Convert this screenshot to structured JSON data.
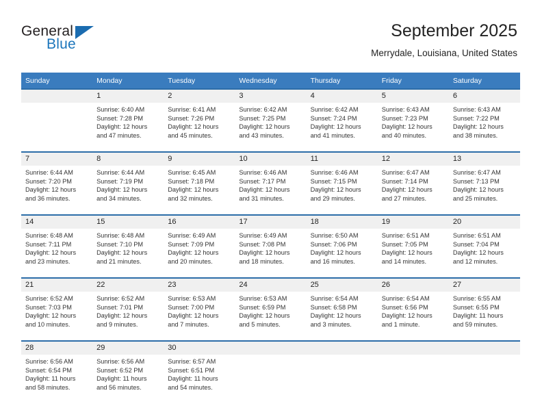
{
  "brand": {
    "line1": "General",
    "line2": "Blue",
    "accent_color": "#1b75bb",
    "triangle_icon": "triangle-logo-icon"
  },
  "header": {
    "title": "September 2025",
    "location": "Merrydale, Louisiana, United States"
  },
  "weekdays": [
    "Sunday",
    "Monday",
    "Tuesday",
    "Wednesday",
    "Thursday",
    "Friday",
    "Saturday"
  ],
  "colors": {
    "header_band": "#3a7cbe",
    "week_rule": "#2c6da8",
    "daynum_band": "#f0f0f0"
  },
  "weeks": [
    [
      {
        "day": "",
        "sunrise": "",
        "sunset": "",
        "daylight1": "",
        "daylight2": "",
        "empty": true
      },
      {
        "day": "1",
        "sunrise": "Sunrise: 6:40 AM",
        "sunset": "Sunset: 7:28 PM",
        "daylight1": "Daylight: 12 hours",
        "daylight2": "and 47 minutes.",
        "empty": false
      },
      {
        "day": "2",
        "sunrise": "Sunrise: 6:41 AM",
        "sunset": "Sunset: 7:26 PM",
        "daylight1": "Daylight: 12 hours",
        "daylight2": "and 45 minutes.",
        "empty": false
      },
      {
        "day": "3",
        "sunrise": "Sunrise: 6:42 AM",
        "sunset": "Sunset: 7:25 PM",
        "daylight1": "Daylight: 12 hours",
        "daylight2": "and 43 minutes.",
        "empty": false
      },
      {
        "day": "4",
        "sunrise": "Sunrise: 6:42 AM",
        "sunset": "Sunset: 7:24 PM",
        "daylight1": "Daylight: 12 hours",
        "daylight2": "and 41 minutes.",
        "empty": false
      },
      {
        "day": "5",
        "sunrise": "Sunrise: 6:43 AM",
        "sunset": "Sunset: 7:23 PM",
        "daylight1": "Daylight: 12 hours",
        "daylight2": "and 40 minutes.",
        "empty": false
      },
      {
        "day": "6",
        "sunrise": "Sunrise: 6:43 AM",
        "sunset": "Sunset: 7:22 PM",
        "daylight1": "Daylight: 12 hours",
        "daylight2": "and 38 minutes.",
        "empty": false
      }
    ],
    [
      {
        "day": "7",
        "sunrise": "Sunrise: 6:44 AM",
        "sunset": "Sunset: 7:20 PM",
        "daylight1": "Daylight: 12 hours",
        "daylight2": "and 36 minutes.",
        "empty": false
      },
      {
        "day": "8",
        "sunrise": "Sunrise: 6:44 AM",
        "sunset": "Sunset: 7:19 PM",
        "daylight1": "Daylight: 12 hours",
        "daylight2": "and 34 minutes.",
        "empty": false
      },
      {
        "day": "9",
        "sunrise": "Sunrise: 6:45 AM",
        "sunset": "Sunset: 7:18 PM",
        "daylight1": "Daylight: 12 hours",
        "daylight2": "and 32 minutes.",
        "empty": false
      },
      {
        "day": "10",
        "sunrise": "Sunrise: 6:46 AM",
        "sunset": "Sunset: 7:17 PM",
        "daylight1": "Daylight: 12 hours",
        "daylight2": "and 31 minutes.",
        "empty": false
      },
      {
        "day": "11",
        "sunrise": "Sunrise: 6:46 AM",
        "sunset": "Sunset: 7:15 PM",
        "daylight1": "Daylight: 12 hours",
        "daylight2": "and 29 minutes.",
        "empty": false
      },
      {
        "day": "12",
        "sunrise": "Sunrise: 6:47 AM",
        "sunset": "Sunset: 7:14 PM",
        "daylight1": "Daylight: 12 hours",
        "daylight2": "and 27 minutes.",
        "empty": false
      },
      {
        "day": "13",
        "sunrise": "Sunrise: 6:47 AM",
        "sunset": "Sunset: 7:13 PM",
        "daylight1": "Daylight: 12 hours",
        "daylight2": "and 25 minutes.",
        "empty": false
      }
    ],
    [
      {
        "day": "14",
        "sunrise": "Sunrise: 6:48 AM",
        "sunset": "Sunset: 7:11 PM",
        "daylight1": "Daylight: 12 hours",
        "daylight2": "and 23 minutes.",
        "empty": false
      },
      {
        "day": "15",
        "sunrise": "Sunrise: 6:48 AM",
        "sunset": "Sunset: 7:10 PM",
        "daylight1": "Daylight: 12 hours",
        "daylight2": "and 21 minutes.",
        "empty": false
      },
      {
        "day": "16",
        "sunrise": "Sunrise: 6:49 AM",
        "sunset": "Sunset: 7:09 PM",
        "daylight1": "Daylight: 12 hours",
        "daylight2": "and 20 minutes.",
        "empty": false
      },
      {
        "day": "17",
        "sunrise": "Sunrise: 6:49 AM",
        "sunset": "Sunset: 7:08 PM",
        "daylight1": "Daylight: 12 hours",
        "daylight2": "and 18 minutes.",
        "empty": false
      },
      {
        "day": "18",
        "sunrise": "Sunrise: 6:50 AM",
        "sunset": "Sunset: 7:06 PM",
        "daylight1": "Daylight: 12 hours",
        "daylight2": "and 16 minutes.",
        "empty": false
      },
      {
        "day": "19",
        "sunrise": "Sunrise: 6:51 AM",
        "sunset": "Sunset: 7:05 PM",
        "daylight1": "Daylight: 12 hours",
        "daylight2": "and 14 minutes.",
        "empty": false
      },
      {
        "day": "20",
        "sunrise": "Sunrise: 6:51 AM",
        "sunset": "Sunset: 7:04 PM",
        "daylight1": "Daylight: 12 hours",
        "daylight2": "and 12 minutes.",
        "empty": false
      }
    ],
    [
      {
        "day": "21",
        "sunrise": "Sunrise: 6:52 AM",
        "sunset": "Sunset: 7:03 PM",
        "daylight1": "Daylight: 12 hours",
        "daylight2": "and 10 minutes.",
        "empty": false
      },
      {
        "day": "22",
        "sunrise": "Sunrise: 6:52 AM",
        "sunset": "Sunset: 7:01 PM",
        "daylight1": "Daylight: 12 hours",
        "daylight2": "and 9 minutes.",
        "empty": false
      },
      {
        "day": "23",
        "sunrise": "Sunrise: 6:53 AM",
        "sunset": "Sunset: 7:00 PM",
        "daylight1": "Daylight: 12 hours",
        "daylight2": "and 7 minutes.",
        "empty": false
      },
      {
        "day": "24",
        "sunrise": "Sunrise: 6:53 AM",
        "sunset": "Sunset: 6:59 PM",
        "daylight1": "Daylight: 12 hours",
        "daylight2": "and 5 minutes.",
        "empty": false
      },
      {
        "day": "25",
        "sunrise": "Sunrise: 6:54 AM",
        "sunset": "Sunset: 6:58 PM",
        "daylight1": "Daylight: 12 hours",
        "daylight2": "and 3 minutes.",
        "empty": false
      },
      {
        "day": "26",
        "sunrise": "Sunrise: 6:54 AM",
        "sunset": "Sunset: 6:56 PM",
        "daylight1": "Daylight: 12 hours",
        "daylight2": "and 1 minute.",
        "empty": false
      },
      {
        "day": "27",
        "sunrise": "Sunrise: 6:55 AM",
        "sunset": "Sunset: 6:55 PM",
        "daylight1": "Daylight: 11 hours",
        "daylight2": "and 59 minutes.",
        "empty": false
      }
    ],
    [
      {
        "day": "28",
        "sunrise": "Sunrise: 6:56 AM",
        "sunset": "Sunset: 6:54 PM",
        "daylight1": "Daylight: 11 hours",
        "daylight2": "and 58 minutes.",
        "empty": false
      },
      {
        "day": "29",
        "sunrise": "Sunrise: 6:56 AM",
        "sunset": "Sunset: 6:52 PM",
        "daylight1": "Daylight: 11 hours",
        "daylight2": "and 56 minutes.",
        "empty": false
      },
      {
        "day": "30",
        "sunrise": "Sunrise: 6:57 AM",
        "sunset": "Sunset: 6:51 PM",
        "daylight1": "Daylight: 11 hours",
        "daylight2": "and 54 minutes.",
        "empty": false
      },
      {
        "day": "",
        "sunrise": "",
        "sunset": "",
        "daylight1": "",
        "daylight2": "",
        "empty": true
      },
      {
        "day": "",
        "sunrise": "",
        "sunset": "",
        "daylight1": "",
        "daylight2": "",
        "empty": true
      },
      {
        "day": "",
        "sunrise": "",
        "sunset": "",
        "daylight1": "",
        "daylight2": "",
        "empty": true
      },
      {
        "day": "",
        "sunrise": "",
        "sunset": "",
        "daylight1": "",
        "daylight2": "",
        "empty": true
      }
    ]
  ]
}
